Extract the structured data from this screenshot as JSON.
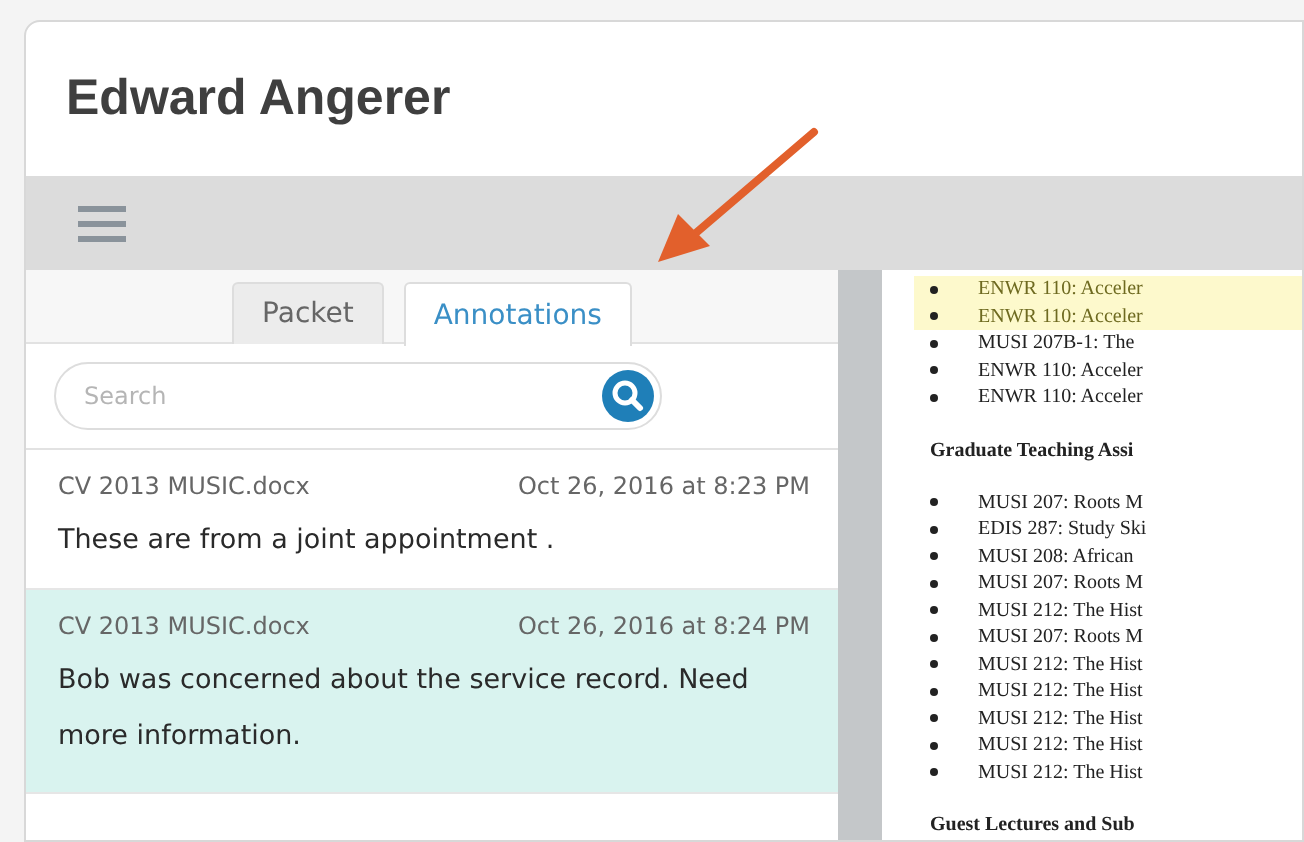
{
  "window": {
    "title": "Edward Angerer"
  },
  "tabs": [
    {
      "label": "Packet",
      "selected": false
    },
    {
      "label": "Annotations",
      "selected": true
    }
  ],
  "search": {
    "placeholder": "Search"
  },
  "annotations": [
    {
      "file": "CV 2013 MUSIC.docx",
      "time": "Oct 26, 2016 at 8:23 PM",
      "text": "These are from a joint appointment .",
      "selected": false
    },
    {
      "file": "CV 2013 MUSIC.docx",
      "time": "Oct 26, 2016 at 8:24 PM",
      "text": "Bob was concerned about the service record. Need more information.",
      "selected": true
    }
  ],
  "document": [
    {
      "kind": "bullet",
      "text": "ENWR 110: Acceler",
      "highlighted": true
    },
    {
      "kind": "bullet",
      "text": "ENWR 110: Acceler",
      "highlighted": true
    },
    {
      "kind": "bullet",
      "text": "MUSI 207B-1:  The",
      "highlighted": false
    },
    {
      "kind": "bullet",
      "text": "ENWR 110: Acceler",
      "highlighted": false
    },
    {
      "kind": "bullet",
      "text": "ENWR 110: Acceler",
      "highlighted": false
    },
    {
      "kind": "heading",
      "text": "Graduate Teaching Assi"
    },
    {
      "kind": "bullet",
      "text": "MUSI 207: Roots M",
      "highlighted": false
    },
    {
      "kind": "bullet",
      "text": "EDIS 287: Study Ski",
      "highlighted": false
    },
    {
      "kind": "bullet",
      "text": "MUSI 208: African",
      "highlighted": false
    },
    {
      "kind": "bullet",
      "text": "MUSI 207: Roots M",
      "highlighted": false
    },
    {
      "kind": "bullet",
      "text": "MUSI 212: The Hist",
      "highlighted": false
    },
    {
      "kind": "bullet",
      "text": "MUSI 207: Roots M",
      "highlighted": false
    },
    {
      "kind": "bullet",
      "text": "MUSI 212: The Hist",
      "highlighted": false
    },
    {
      "kind": "bullet",
      "text": "MUSI 212: The Hist",
      "highlighted": false
    },
    {
      "kind": "bullet",
      "text": "MUSI 212: The Hist",
      "highlighted": false
    },
    {
      "kind": "bullet",
      "text": "MUSI 212: The Hist",
      "highlighted": false
    },
    {
      "kind": "bullet",
      "text": "MUSI 212: The Hist",
      "highlighted": false
    },
    {
      "kind": "heading",
      "text": "Guest Lectures and Sub"
    }
  ]
}
